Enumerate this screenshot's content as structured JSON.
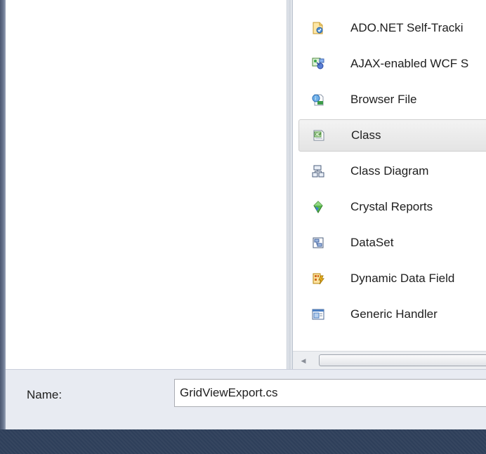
{
  "templates": [
    {
      "label": "ADO.NET Self-Tracki",
      "icon": "ado-net-self-tracking-icon"
    },
    {
      "label": "AJAX-enabled WCF S",
      "icon": "ajax-wcf-service-icon"
    },
    {
      "label": "Browser File",
      "icon": "browser-file-icon"
    },
    {
      "label": "Class",
      "icon": "csharp-class-icon",
      "selected": true
    },
    {
      "label": "Class Diagram",
      "icon": "class-diagram-icon"
    },
    {
      "label": "Crystal Reports",
      "icon": "crystal-reports-icon"
    },
    {
      "label": "DataSet",
      "icon": "dataset-icon"
    },
    {
      "label": "Dynamic Data Field",
      "icon": "dynamic-data-field-icon"
    },
    {
      "label": "Generic Handler",
      "icon": "generic-handler-icon"
    }
  ],
  "name_row": {
    "label": "Name:",
    "value": "GridViewExport.cs"
  },
  "colors": {
    "selection": "#e4e4e4",
    "name_row_bg": "#e8ebf2",
    "bottom_bar": "#2e3f5a"
  }
}
